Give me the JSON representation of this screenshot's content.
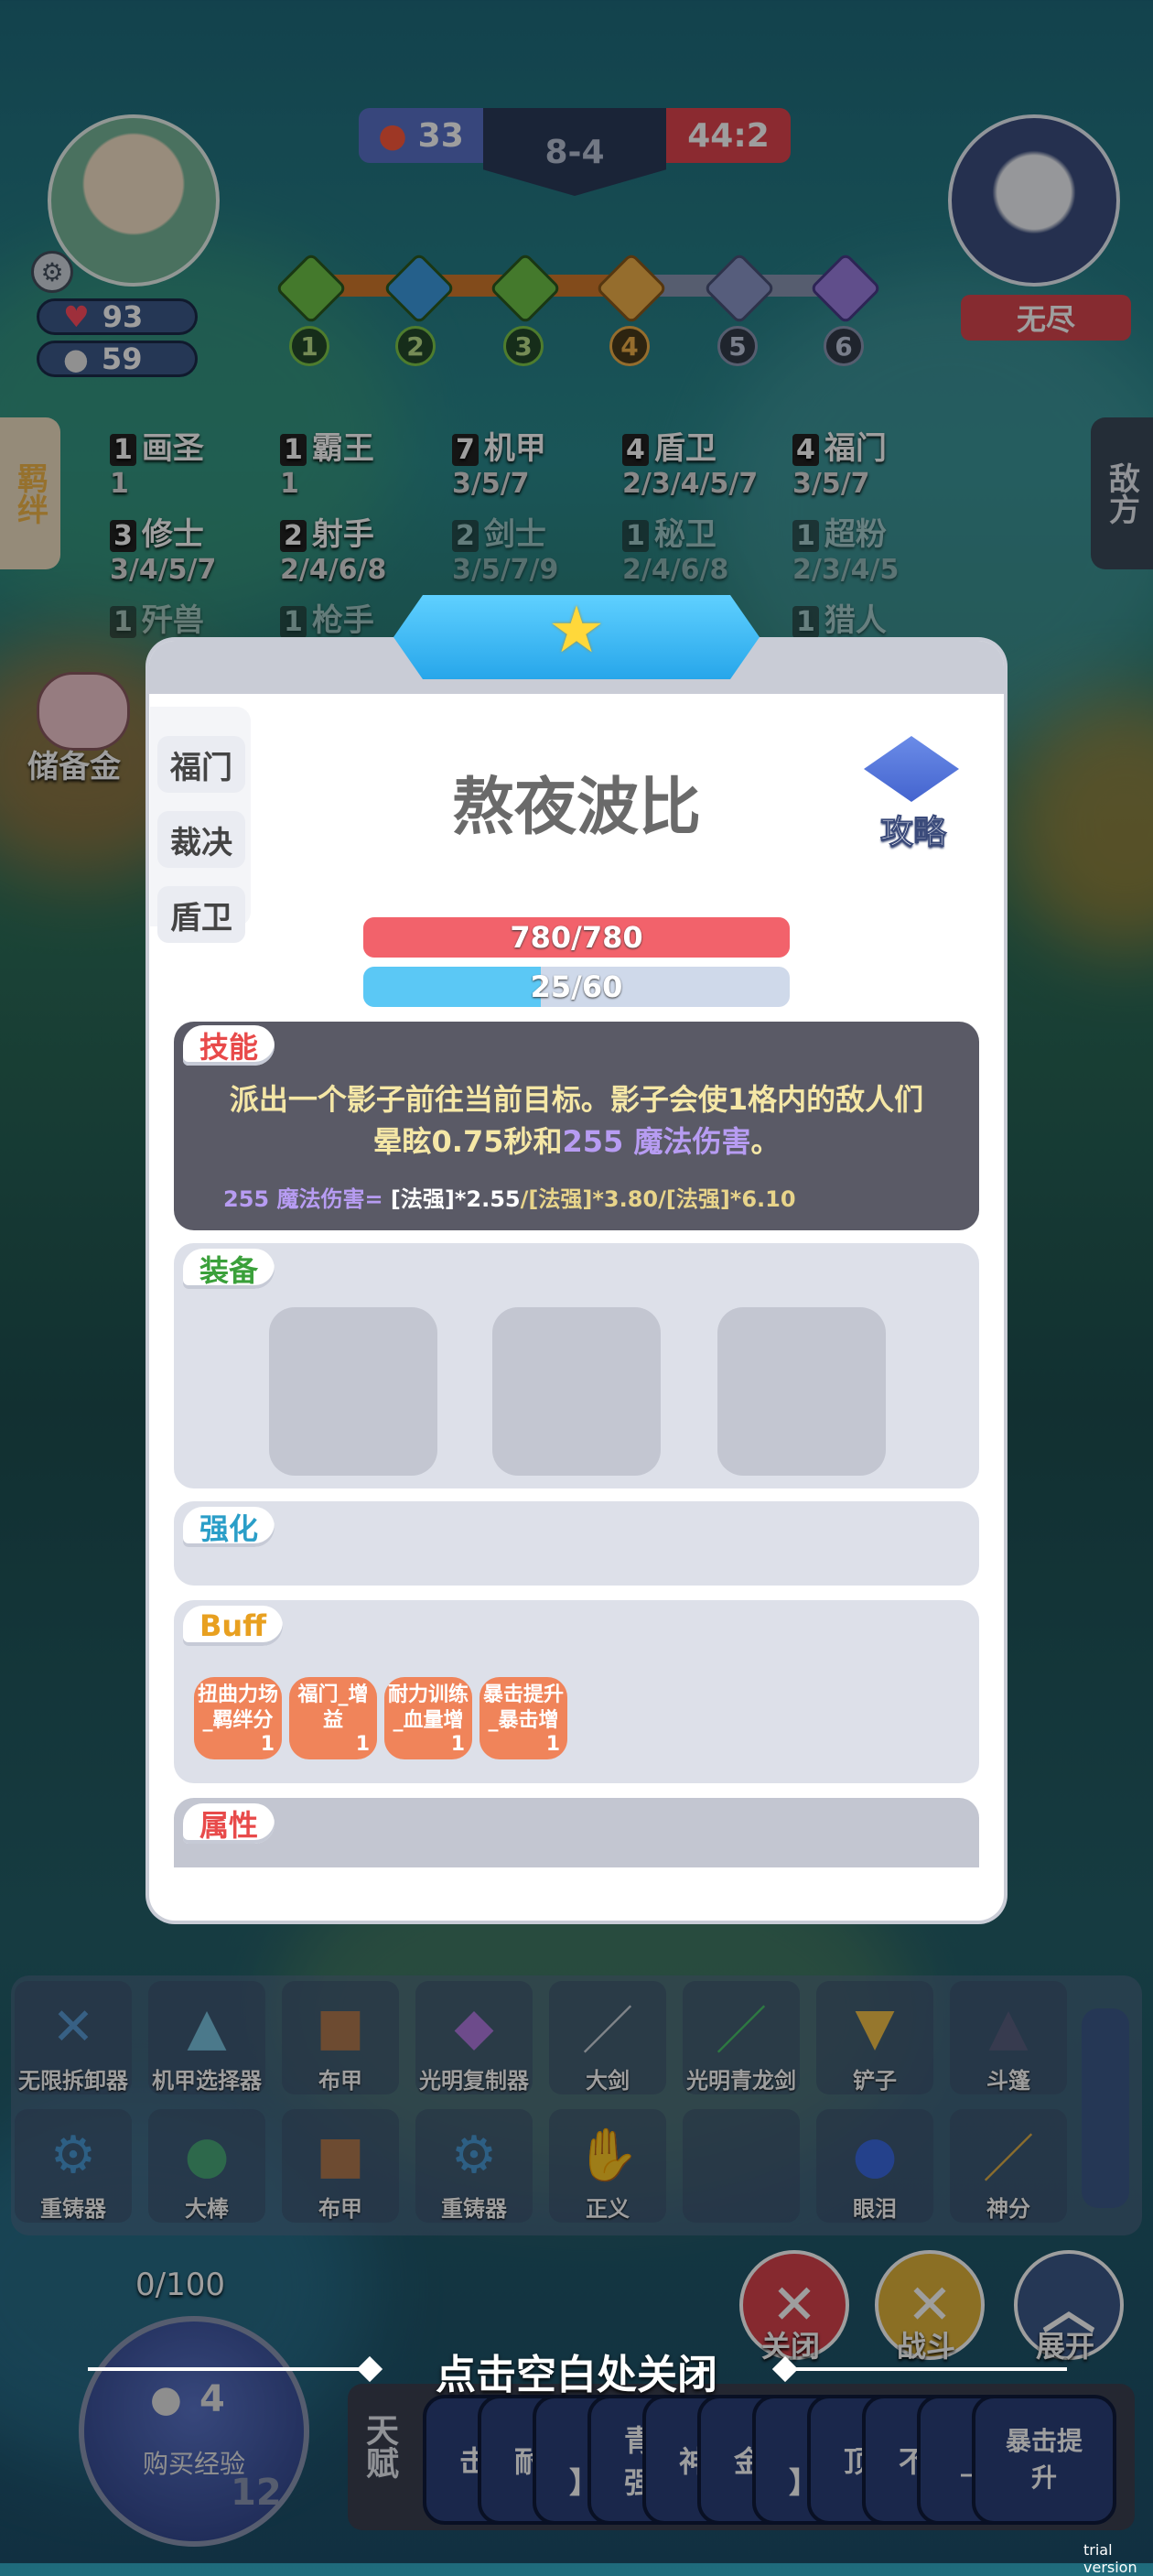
{
  "hud": {
    "player_health": "93",
    "player_gold": "59",
    "score_left": "33",
    "stage": "8-4",
    "score_right": "44:2",
    "enemy_name": "无尽",
    "stages": [
      "1",
      "2",
      "3",
      "4",
      "5",
      "6"
    ]
  },
  "side_tabs": {
    "left": "羁绊",
    "right": "敌方"
  },
  "traits": [
    {
      "count": "1",
      "name": "画圣",
      "levels": "1"
    },
    {
      "count": "1",
      "name": "霸王",
      "levels": "1"
    },
    {
      "count": "7",
      "name": "机甲",
      "levels": "3/5/7"
    },
    {
      "count": "4",
      "name": "盾卫",
      "levels": "2/3/4/5/7"
    },
    {
      "count": "4",
      "name": "福门",
      "levels": "3/5/7"
    },
    {
      "count": "3",
      "name": "修士",
      "levels": "3/4/5/7"
    },
    {
      "count": "2",
      "name": "射手",
      "levels": "2/4/6/8"
    },
    {
      "count": "2",
      "name": "剑士",
      "levels": "3/5/7/9"
    },
    {
      "count": "1",
      "name": "秘卫",
      "levels": "2/4/6/8"
    },
    {
      "count": "1",
      "name": "超粉",
      "levels": "2/3/4/5"
    }
  ],
  "traits_row3": [
    {
      "count": "1",
      "name": "歼兽"
    },
    {
      "count": "1",
      "name": "枪手"
    },
    {
      "count": "1",
      "name": "猎人"
    }
  ],
  "savings_label": "储备金",
  "hero": {
    "name": "熬夜波比",
    "strategy_label": "攻略",
    "traits": [
      "福门",
      "裁决",
      "盾卫"
    ],
    "hp_text": "780/780",
    "mana_text": "25/60",
    "hp_fraction": 1.0,
    "mana_fraction": 0.4167
  },
  "skill": {
    "tag": "技能",
    "desc_line1": "派出一个影子前往当前目标。影子会使1格内的敌人们",
    "desc_line2_a": "晕眩0.75秒和",
    "desc_line2_b": "255 魔法伤害",
    "desc_line2_c": "。",
    "formula_a": "255 魔法伤害=",
    "formula_b": " [法强]*2.55",
    "formula_c": "/[法强]*3.80/[法强]*6.10"
  },
  "equipment": {
    "tag": "装备"
  },
  "enhance": {
    "tag": "强化"
  },
  "buff": {
    "tag": "Buff",
    "items": [
      {
        "line1": "扭曲力场",
        "line2": "_羁绊分",
        "count": "1"
      },
      {
        "line1": "福门_增",
        "line2": "益",
        "count": "1"
      },
      {
        "line1": "耐力训练",
        "line2": "_血量增",
        "count": "1"
      },
      {
        "line1": "暴击提升",
        "line2": "_暴击增",
        "count": "1"
      }
    ]
  },
  "attributes": {
    "tag": "属性"
  },
  "shelf": {
    "row1": [
      "无限拆卸器",
      "机甲选择器",
      "布甲",
      "光明复制器",
      "大剑",
      "光明青龙剑",
      "铲子",
      "斗篷"
    ],
    "row2": [
      "重铸器",
      "大棒",
      "布甲",
      "重铸器",
      "正义",
      "",
      "眼泪",
      "神分"
    ]
  },
  "bottom": {
    "exp_text": "0/100",
    "buy_exp_cost": "4",
    "buy_exp_label": "购买经验",
    "level": "12",
    "close_hint": "点击空白处关闭",
    "btn_close": "关闭",
    "btn_fight": "战斗",
    "btn_expand": "展开",
    "talent_label": "天赋",
    "talent_cards": [
      "击",
      "耐",
      "【\n】",
      "青\n强",
      "神",
      "金",
      "【\n】",
      "顶",
      "不",
      "_",
      "暴击提\n升"
    ]
  },
  "watermark": "trial version",
  "colors": {
    "hp": "#f2626b",
    "mana": "#5bc8f5",
    "skill_panel": "#5a5a66",
    "skill_text": "#f5e7a6",
    "magic_damage": "#b79cf2",
    "buff_chip": "#f0845a"
  }
}
